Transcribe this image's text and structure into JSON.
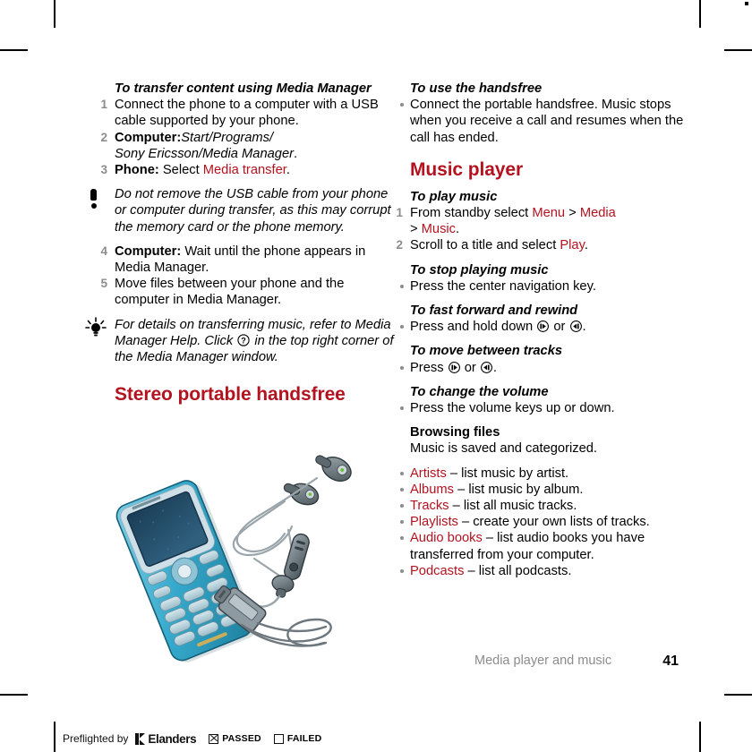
{
  "page": {
    "footer_section": "Media player and music",
    "page_number": "41"
  },
  "left_column": {
    "proc1_title": "To transfer content using Media Manager",
    "proc1_steps": [
      {
        "num": "1",
        "parts": [
          {
            "t": "Connect the phone to a computer with a USB cable supported by your phone.",
            "style": "normal"
          }
        ]
      },
      {
        "num": "2",
        "parts": [
          {
            "t": "Computer:",
            "style": "bold"
          },
          {
            "t": " ",
            "style": "normal"
          },
          {
            "t": "Start/Programs/",
            "style": "italic"
          },
          {
            "t": "\n",
            "style": "break"
          },
          {
            "t": "Sony Ericsson/Media Manager",
            "style": "italic"
          },
          {
            "t": ".",
            "style": "normal"
          }
        ]
      },
      {
        "num": "3",
        "parts": [
          {
            "t": "Phone:",
            "style": "bold"
          },
          {
            "t": " Select ",
            "style": "normal"
          },
          {
            "t": "Media transfer",
            "style": "red"
          },
          {
            "t": ".",
            "style": "normal"
          }
        ]
      }
    ],
    "note1": "Do not remove the USB cable from your phone or computer during transfer, as this may corrupt the memory card or the phone memory.",
    "note1_icon": "exclamation-note-icon",
    "proc1_steps_cont": [
      {
        "num": "4",
        "parts": [
          {
            "t": "Computer:",
            "style": "bold"
          },
          {
            "t": " Wait until the phone appears in Media Manager.",
            "style": "normal"
          }
        ]
      },
      {
        "num": "5",
        "parts": [
          {
            "t": "Move files between your phone and the computer in Media Manager.",
            "style": "normal"
          }
        ]
      }
    ],
    "tip1_icon": "lightbulb-tip-icon",
    "tip1_pre": "For details on transferring music, refer to Media Manager Help. Click ",
    "tip1_glyph": "help-question-icon",
    "tip1_post": " in the top right corner of the Media Manager window.",
    "section_heading": "Stereo portable handsfree",
    "illustration_name": "phone-with-stereo-handsfree-illustration"
  },
  "right_column": {
    "proc_handsfree_title": "To use the handsfree",
    "proc_handsfree_bullets": [
      "Connect the portable handsfree. Music stops when you receive a call and resumes when the call has ended."
    ],
    "section_heading": "Music player",
    "proc_play_title": "To play music",
    "proc_play_steps": [
      {
        "num": "1",
        "parts": [
          {
            "t": "From standby select ",
            "style": "normal"
          },
          {
            "t": "Menu",
            "style": "red"
          },
          {
            "t": " > ",
            "style": "normal"
          },
          {
            "t": "Media",
            "style": "red"
          },
          {
            "t": "\n",
            "style": "break"
          },
          {
            "t": "> ",
            "style": "normal"
          },
          {
            "t": "Music",
            "style": "red"
          },
          {
            "t": ".",
            "style": "normal"
          }
        ]
      },
      {
        "num": "2",
        "parts": [
          {
            "t": "Scroll to a title and select ",
            "style": "normal"
          },
          {
            "t": "Play",
            "style": "red"
          },
          {
            "t": ".",
            "style": "normal"
          }
        ]
      }
    ],
    "proc_stop_title": "To stop playing music",
    "proc_stop_bullets": [
      "Press the center navigation key."
    ],
    "proc_ff_title": "To fast forward and rewind",
    "proc_ff_pre": "Press and hold down ",
    "proc_ff_mid": " or ",
    "proc_ff_post": ".",
    "proc_tracks_title": "To move between tracks",
    "proc_tracks_pre": "Press ",
    "proc_tracks_mid": " or ",
    "proc_tracks_post": ".",
    "proc_vol_title": "To change the volume",
    "proc_vol_bullets": [
      "Press the volume keys up or down."
    ],
    "browsing_title": "Browsing files",
    "browsing_text": "Music is saved and categorized.",
    "browsing_items": [
      {
        "label": "Artists",
        "desc": " – list music by artist."
      },
      {
        "label": "Albums",
        "desc": " – list music by album."
      },
      {
        "label": "Tracks",
        "desc": " – list all music tracks."
      },
      {
        "label": "Playlists",
        "desc": " – create your own lists of tracks."
      },
      {
        "label": "Audio books",
        "desc": " – list audio books you have transferred from your computer."
      },
      {
        "label": "Podcasts",
        "desc": " – list all podcasts."
      }
    ],
    "key_right_icon": "nav-key-right-icon",
    "key_left_icon": "nav-key-left-icon"
  },
  "preflight": {
    "label": "Preflighted by",
    "brand": "Elanders",
    "passed_label": "PASSED",
    "failed_label": "FAILED",
    "passed_checked": true,
    "failed_checked": false
  },
  "colors": {
    "accent_red": "#b3121f",
    "step_number_gray": "#8c8c8c",
    "footer_gray": "#8c8c8c"
  }
}
